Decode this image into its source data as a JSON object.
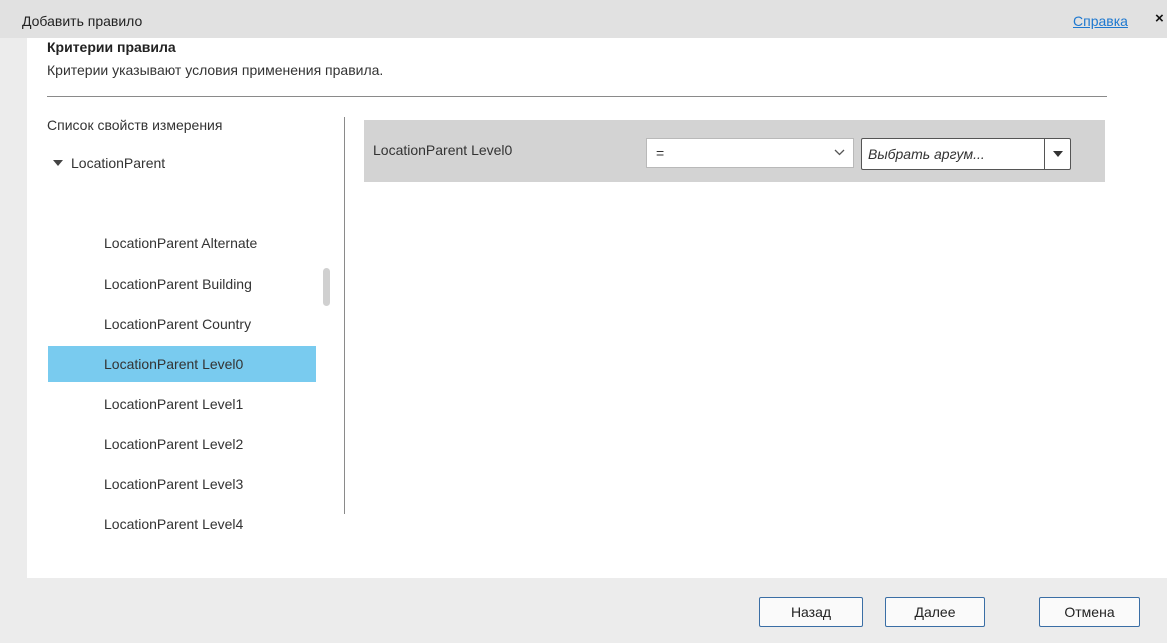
{
  "dialog": {
    "title": "Добавить правило",
    "help_link": "Справка",
    "close_glyph": "×",
    "close_icon": "close-icon"
  },
  "criteria": {
    "title": "Критерии правила",
    "description": "Критерии указывают условия применения правила."
  },
  "property_list": {
    "heading": "Список свойств измерения",
    "root": {
      "label": "LocationParent",
      "expanded": true,
      "icon": "caret-down-icon"
    },
    "items": [
      {
        "label": "LocationParent Alternate",
        "selected": false
      },
      {
        "label": "LocationParent Building",
        "selected": false
      },
      {
        "label": "LocationParent Country",
        "selected": false
      },
      {
        "label": "LocationParent Level0",
        "selected": true
      },
      {
        "label": "LocationParent Level1",
        "selected": false
      },
      {
        "label": "LocationParent Level2",
        "selected": false
      },
      {
        "label": "LocationParent Level3",
        "selected": false
      },
      {
        "label": "LocationParent Level4",
        "selected": false
      }
    ],
    "selected_color": "#79cbef"
  },
  "criterion_row": {
    "label": "LocationParent Level0",
    "operator": "=",
    "operator_icon": "chevron-down-icon",
    "argument_placeholder": "Выбрать аргум...",
    "argument_button_icon": "dropdown-triangle-icon"
  },
  "footer": {
    "back_label": "Назад",
    "next_label": "Далее",
    "cancel_label": "Отмена"
  }
}
